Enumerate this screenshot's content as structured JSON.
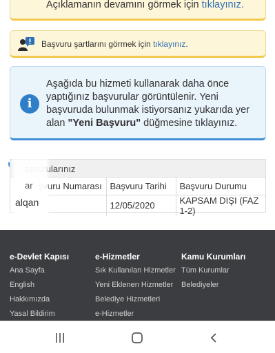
{
  "notice_top": {
    "text": "Açıklamanın devamını görmek için ",
    "link": "tıklayınız."
  },
  "notice_requirements": {
    "text": "Başvuru şartlarını görmek için ",
    "link": "tıklayınız",
    "suffix": "."
  },
  "info": {
    "text_before": "Aşağıda bu hizmeti kullanarak daha önce yaptığınız başvurular görüntülenir. Yeni başvuruda bulunmak istiyorsanız yukarıda yer alan ",
    "bold": "\"Yeni Başvuru\"",
    "text_after": " düğmesine tıklayınız."
  },
  "applications": {
    "header": "aşvurularınız",
    "columns": [
      "şvuru Numarası",
      "Başvuru Tarihi",
      "Başvuru Durumu"
    ],
    "rows": [
      {
        "number": "",
        "date": "12/05/2020",
        "status": "KAPSAM DIŞI (FAZ 1-2)"
      }
    ],
    "overlay_line1": "ar",
    "overlay_line2": "alqan"
  },
  "footer": {
    "col1": {
      "title": "e-Devlet Kapısı",
      "links": [
        "Ana Sayfa",
        "English",
        "Hakkımızda",
        "Yasal Bildirim"
      ]
    },
    "col2": {
      "title": "e-Hizmetler",
      "links": [
        "Sık Kullanılan Hizmetler",
        "Yeni Eklenen Hizmetler",
        "Belediye Hizmetleri",
        "e-Hizmetler"
      ]
    },
    "col3": {
      "title": "Kamu Kurumları",
      "links": [
        "Tüm Kurumlar",
        "Belediyeler"
      ]
    }
  },
  "colors": {
    "link": "#2f6fb3",
    "warning_bg": "#fdf6d9",
    "warning_border": "#f2c94c",
    "info_bg": "#eaf4fb",
    "info_border": "#3d8ed6",
    "footer_bg": "#3b3d40"
  },
  "icons": {
    "requirements": "person-alert-icon",
    "info": "info-icon",
    "nav_recent": "recent-apps-icon",
    "nav_home": "home-icon",
    "nav_back": "back-icon"
  }
}
